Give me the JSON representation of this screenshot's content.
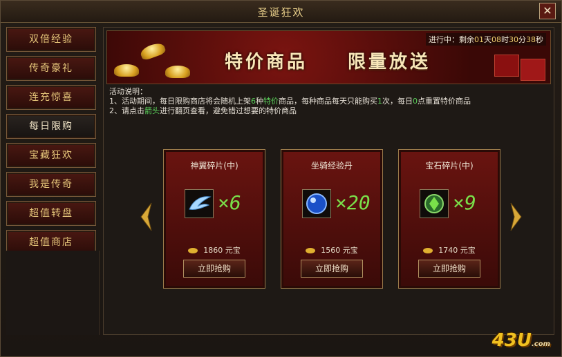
{
  "window": {
    "title": "圣诞狂欢",
    "close_glyph": "✕"
  },
  "sidebar": {
    "items": [
      {
        "label": "双倍经验"
      },
      {
        "label": "传奇豪礼"
      },
      {
        "label": "连充惊喜"
      },
      {
        "label": "每日限购",
        "active": true
      },
      {
        "label": "宝藏狂欢"
      },
      {
        "label": "我是传奇"
      },
      {
        "label": "超值转盘"
      },
      {
        "label": "超值商店"
      }
    ]
  },
  "banner": {
    "timer_prefix": "进行中：剩余",
    "days": "01",
    "days_unit": "天",
    "hours": "08",
    "hours_unit": "时",
    "minutes": "30",
    "minutes_unit": "分",
    "seconds": "38",
    "seconds_unit": "秒",
    "headline_left": "特价商品",
    "headline_right": "限量放送"
  },
  "description": {
    "heading": "活动说明：",
    "line1_a": "1、活动期间，每日限购商店将会随机上架",
    "line1_b": "6",
    "line1_c": "种",
    "line1_d": "特价",
    "line1_e": "商品，每种商品每天只能购买",
    "line1_f": "1",
    "line1_g": "次，每日",
    "line1_h": "0",
    "line1_i": "点重置特价商品",
    "line2_a": "2、请点击",
    "line2_b": "箭头",
    "line2_c": "进行翻页查看，避免错过想要的特价商品"
  },
  "products": [
    {
      "name": "神翼碎片(中)",
      "quantity": "×6",
      "price": "1860",
      "currency": "元宝",
      "buy_label": "立即抢购",
      "icon": "wing-icon"
    },
    {
      "name": "坐骑经验丹",
      "quantity": "×20",
      "price": "1560",
      "currency": "元宝",
      "buy_label": "立即抢购",
      "icon": "blue-orb-icon"
    },
    {
      "name": "宝石碎片(中)",
      "quantity": "×9",
      "price": "1740",
      "currency": "元宝",
      "buy_label": "立即抢购",
      "icon": "green-gem-icon"
    }
  ],
  "logo": {
    "text": "43U",
    "suffix": ".com"
  },
  "colors": {
    "accent_gold": "#e6c67a",
    "highlight_green": "#5ad05a",
    "tab_red": "#4a1812"
  }
}
